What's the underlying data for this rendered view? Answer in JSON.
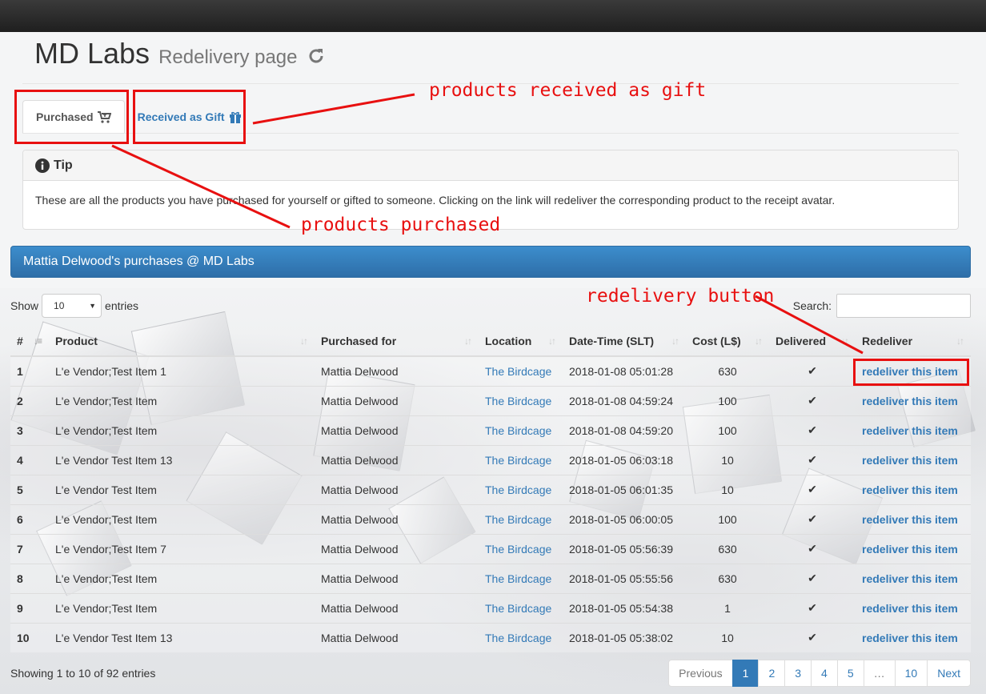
{
  "header": {
    "brand": "MD Labs",
    "subtitle": "Redelivery page",
    "refresh_icon": "refresh-icon"
  },
  "tabs": [
    {
      "label": "Purchased",
      "icon": "cart-icon",
      "active": true
    },
    {
      "label": "Received as Gift",
      "icon": "gift-icon",
      "active": false
    }
  ],
  "tip": {
    "title": "Tip",
    "icon": "info-circle-icon",
    "text": "These are all the products you have purchased for yourself or gifted to someone. Clicking on the link will redeliver the corresponding product to the receipt avatar."
  },
  "panel": {
    "title": "Mattia Delwood's purchases @ MD Labs"
  },
  "length_control": {
    "show": "Show",
    "value": "10",
    "entries": "entries"
  },
  "search": {
    "label": "Search:",
    "value": ""
  },
  "table": {
    "columns": [
      "#",
      "Product",
      "Purchased for",
      "Location",
      "Date-Time (SLT)",
      "Cost (L$)",
      "Delivered",
      "Redeliver"
    ],
    "rows": [
      {
        "num": "1",
        "product": "L'e Vendor;Test Item 1",
        "for": "Mattia Delwood",
        "location": "The Birdcage",
        "datetime": "2018-01-08 05:01:28",
        "cost": "630",
        "delivered": "✔",
        "action": "redeliver this item"
      },
      {
        "num": "2",
        "product": "L'e Vendor;Test Item",
        "for": "Mattia Delwood",
        "location": "The Birdcage",
        "datetime": "2018-01-08 04:59:24",
        "cost": "100",
        "delivered": "✔",
        "action": "redeliver this item"
      },
      {
        "num": "3",
        "product": "L'e Vendor;Test Item",
        "for": "Mattia Delwood",
        "location": "The Birdcage",
        "datetime": "2018-01-08 04:59:20",
        "cost": "100",
        "delivered": "✔",
        "action": "redeliver this item"
      },
      {
        "num": "4",
        "product": "L'e Vendor Test Item 13",
        "for": "Mattia Delwood",
        "location": "The Birdcage",
        "datetime": "2018-01-05 06:03:18",
        "cost": "10",
        "delivered": "✔",
        "action": "redeliver this item"
      },
      {
        "num": "5",
        "product": "L'e Vendor Test Item",
        "for": "Mattia Delwood",
        "location": "The Birdcage",
        "datetime": "2018-01-05 06:01:35",
        "cost": "10",
        "delivered": "✔",
        "action": "redeliver this item"
      },
      {
        "num": "6",
        "product": "L'e Vendor;Test Item",
        "for": "Mattia Delwood",
        "location": "The Birdcage",
        "datetime": "2018-01-05 06:00:05",
        "cost": "100",
        "delivered": "✔",
        "action": "redeliver this item"
      },
      {
        "num": "7",
        "product": "L'e Vendor;Test Item 7",
        "for": "Mattia Delwood",
        "location": "The Birdcage",
        "datetime": "2018-01-05 05:56:39",
        "cost": "630",
        "delivered": "✔",
        "action": "redeliver this item"
      },
      {
        "num": "8",
        "product": "L'e Vendor;Test Item",
        "for": "Mattia Delwood",
        "location": "The Birdcage",
        "datetime": "2018-01-05 05:55:56",
        "cost": "630",
        "delivered": "✔",
        "action": "redeliver this item"
      },
      {
        "num": "9",
        "product": "L'e Vendor;Test Item",
        "for": "Mattia Delwood",
        "location": "The Birdcage",
        "datetime": "2018-01-05 05:54:38",
        "cost": "1",
        "delivered": "✔",
        "action": "redeliver this item"
      },
      {
        "num": "10",
        "product": "L'e Vendor Test Item 13",
        "for": "Mattia Delwood",
        "location": "The Birdcage",
        "datetime": "2018-01-05 05:38:02",
        "cost": "10",
        "delivered": "✔",
        "action": "redeliver this item"
      }
    ]
  },
  "footer": {
    "info": "Showing 1 to 10 of 92 entries",
    "pagination": [
      "Previous",
      "1",
      "2",
      "3",
      "4",
      "5",
      "…",
      "10",
      "Next"
    ],
    "current_page": "1"
  },
  "annotations": {
    "gift": "products received as gift",
    "purchased": "products purchased",
    "redelivery": "redelivery button",
    "color": "#e81010"
  },
  "colors": {
    "link": "#337ab7",
    "panel": "#337ab7",
    "topbar": "#2a2a2a"
  }
}
